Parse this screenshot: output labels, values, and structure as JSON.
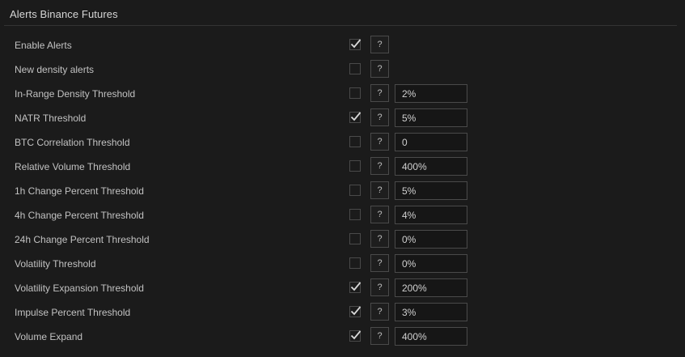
{
  "panel": {
    "title": "Alerts Binance Futures"
  },
  "help_label": "?",
  "rows": [
    {
      "label": "Enable Alerts",
      "checked": true,
      "value": null
    },
    {
      "label": "New density alerts",
      "checked": false,
      "value": null
    },
    {
      "label": "In-Range Density Threshold",
      "checked": false,
      "value": "2%"
    },
    {
      "label": "NATR Threshold",
      "checked": true,
      "value": "5%"
    },
    {
      "label": "BTC Correlation Threshold",
      "checked": false,
      "value": "0"
    },
    {
      "label": "Relative Volume Threshold",
      "checked": false,
      "value": "400%"
    },
    {
      "label": "1h Change Percent Threshold",
      "checked": false,
      "value": "5%"
    },
    {
      "label": "4h Change Percent Threshold",
      "checked": false,
      "value": "4%"
    },
    {
      "label": "24h Change Percent Threshold",
      "checked": false,
      "value": "0%"
    },
    {
      "label": "Volatility Threshold",
      "checked": false,
      "value": "0%"
    },
    {
      "label": "Volatility Expansion Threshold",
      "checked": true,
      "value": "200%"
    },
    {
      "label": "Impulse Percent Threshold",
      "checked": true,
      "value": "3%"
    },
    {
      "label": "Volume Expand",
      "checked": true,
      "value": "400%"
    }
  ],
  "icons": {
    "check": "checkmark-icon",
    "help": "help-icon"
  },
  "colors": {
    "background": "#0f0f0f",
    "panel": "#1b1b1b",
    "border": "#4a4a4a",
    "text": "#c2c2c2"
  }
}
